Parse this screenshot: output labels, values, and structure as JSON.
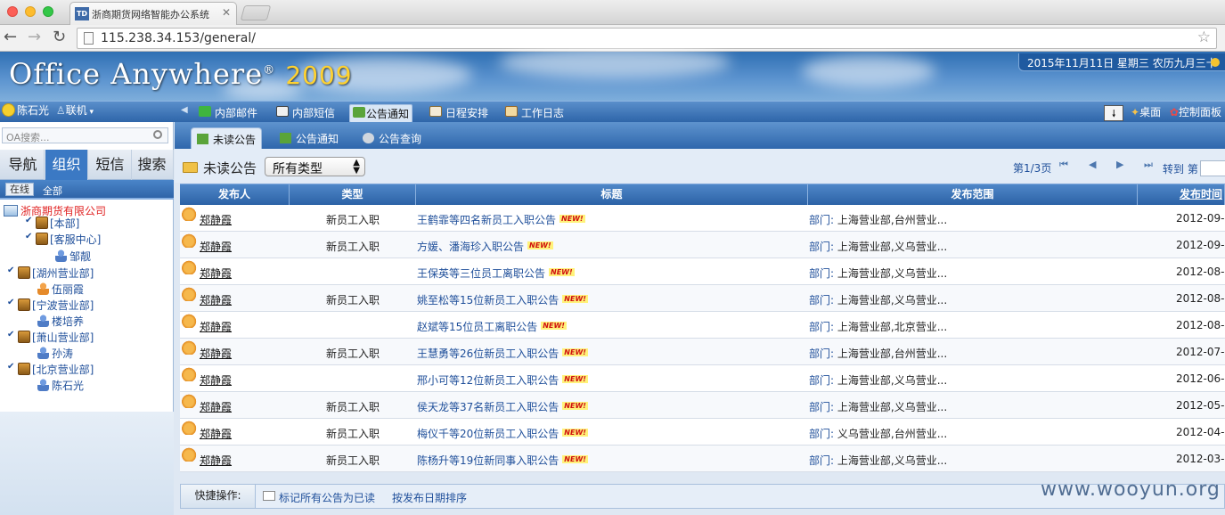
{
  "browser": {
    "tab_title": "浙商期货网络智能办公系统",
    "tab_favicon": "TD",
    "url": "115.238.34.153/general/"
  },
  "banner": {
    "logo_main": "Office Anywhere",
    "logo_reg": "®",
    "logo_year": "2009",
    "date": "2015年11月11日 星期三 农历九月三十"
  },
  "nav": {
    "user": "陈石光",
    "status": "联机",
    "items": [
      {
        "label": "内部邮件",
        "icon": "mail-icon"
      },
      {
        "label": "内部短信",
        "icon": "sms-icon"
      },
      {
        "label": "公告通知",
        "icon": "announcement-icon"
      },
      {
        "label": "日程安排",
        "icon": "calendar-icon"
      },
      {
        "label": "工作日志",
        "icon": "diary-icon"
      }
    ],
    "desktop": "桌面",
    "control_panel": "控制面板"
  },
  "sidebar": {
    "search_placeholder": "OA搜索...",
    "tabs": [
      "导航",
      "组织",
      "短信",
      "搜索"
    ],
    "online": "在线",
    "all": "全部",
    "tree": {
      "company": "浙商期货有限公司",
      "nodes": [
        {
          "label": "[本部]"
        },
        {
          "label": "[客服中心]"
        },
        {
          "label": "邹靓"
        },
        {
          "label": "[湖州营业部]"
        },
        {
          "label": "伍丽霞"
        },
        {
          "label": "[宁波营业部]"
        },
        {
          "label": "楼培养"
        },
        {
          "label": "[萧山营业部]"
        },
        {
          "label": "孙涛"
        },
        {
          "label": "[北京营业部]"
        },
        {
          "label": "陈石光"
        }
      ]
    }
  },
  "subtabs": [
    "未读公告",
    "公告通知",
    "公告查询"
  ],
  "toolbar": {
    "title": "未读公告",
    "type_select": "所有类型",
    "page_info": "第1/3页",
    "goto": "转到 第"
  },
  "table": {
    "headers": [
      "发布人",
      "类型",
      "标题",
      "发布范围",
      "发布时间"
    ],
    "new_badge": "NEW!",
    "scope_label": "部门:",
    "rows": [
      {
        "publisher": "郑静霞",
        "type": "新员工入职",
        "title": "王鹤霏等四名新员工入职公告",
        "scope": "上海营业部,台州营业...",
        "date": "2012-09-1"
      },
      {
        "publisher": "郑静霞",
        "type": "新员工入职",
        "title": "方媛、潘海珍入职公告",
        "scope": "上海营业部,义乌营业...",
        "date": "2012-09-0"
      },
      {
        "publisher": "郑静霞",
        "type": "",
        "title": "王保英等三位员工离职公告",
        "scope": "上海营业部,义乌营业...",
        "date": "2012-08-2"
      },
      {
        "publisher": "郑静霞",
        "type": "新员工入职",
        "title": "姚至松等15位新员工入职公告",
        "scope": "上海营业部,义乌营业...",
        "date": "2012-08-1"
      },
      {
        "publisher": "郑静霞",
        "type": "",
        "title": "赵斌等15位员工离职公告",
        "scope": "上海营业部,北京营业...",
        "date": "2012-08-0"
      },
      {
        "publisher": "郑静霞",
        "type": "新员工入职",
        "title": "王慧勇等26位新员工入职公告",
        "scope": "上海营业部,台州营业...",
        "date": "2012-07-2"
      },
      {
        "publisher": "郑静霞",
        "type": "",
        "title": "邢小可等12位新员工入职公告",
        "scope": "上海营业部,义乌营业...",
        "date": "2012-06-2"
      },
      {
        "publisher": "郑静霞",
        "type": "新员工入职",
        "title": "侯天龙等37名新员工入职公告",
        "scope": "上海营业部,义乌营业...",
        "date": "2012-05-2"
      },
      {
        "publisher": "郑静霞",
        "type": "新员工入职",
        "title": "梅仪千等20位新员工入职公告",
        "scope": "义乌营业部,台州营业...",
        "date": "2012-04-1"
      },
      {
        "publisher": "郑静霞",
        "type": "新员工入职",
        "title": "陈杨升等19位新同事入职公告",
        "scope": "上海营业部,义乌营业...",
        "date": "2012-03-2"
      }
    ]
  },
  "quick": {
    "label": "快捷操作:",
    "mark_read": "标记所有公告为已读",
    "sort": "按发布日期排序"
  },
  "watermark": "www.wooyun.org"
}
